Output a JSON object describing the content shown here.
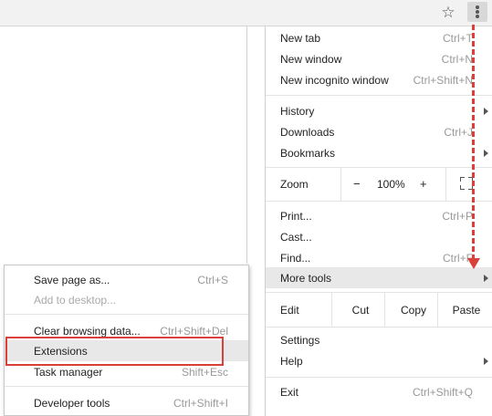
{
  "toolbar": {
    "bookmark_icon": "star-icon",
    "menu_icon": "vertical-ellipsis-icon"
  },
  "menu": {
    "new_tab": {
      "label": "New tab",
      "shortcut": "Ctrl+T"
    },
    "new_window": {
      "label": "New window",
      "shortcut": "Ctrl+N"
    },
    "new_incognito": {
      "label": "New incognito window",
      "shortcut": "Ctrl+Shift+N"
    },
    "history": {
      "label": "History"
    },
    "downloads": {
      "label": "Downloads",
      "shortcut": "Ctrl+J"
    },
    "bookmarks": {
      "label": "Bookmarks"
    },
    "zoom": {
      "label": "Zoom",
      "minus": "−",
      "value": "100%",
      "plus": "+",
      "fullscreen_icon": "fullscreen-icon"
    },
    "print": {
      "label": "Print...",
      "shortcut": "Ctrl+P"
    },
    "cast": {
      "label": "Cast..."
    },
    "find": {
      "label": "Find...",
      "shortcut": "Ctrl+F"
    },
    "more_tools": {
      "label": "More tools"
    },
    "edit": {
      "label": "Edit",
      "cut": "Cut",
      "copy": "Copy",
      "paste": "Paste"
    },
    "settings": {
      "label": "Settings"
    },
    "help": {
      "label": "Help"
    },
    "exit": {
      "label": "Exit",
      "shortcut": "Ctrl+Shift+Q"
    }
  },
  "submenu": {
    "save_page": {
      "label": "Save page as...",
      "shortcut": "Ctrl+S"
    },
    "add_desktop": {
      "label": "Add to desktop..."
    },
    "clear_data": {
      "label": "Clear browsing data...",
      "shortcut": "Ctrl+Shift+Del"
    },
    "extensions": {
      "label": "Extensions"
    },
    "task_manager": {
      "label": "Task manager",
      "shortcut": "Shift+Esc"
    },
    "dev_tools": {
      "label": "Developer tools",
      "shortcut": "Ctrl+Shift+I"
    }
  },
  "colors": {
    "highlight": "#d9403a",
    "hover": "#e8e8e8"
  }
}
